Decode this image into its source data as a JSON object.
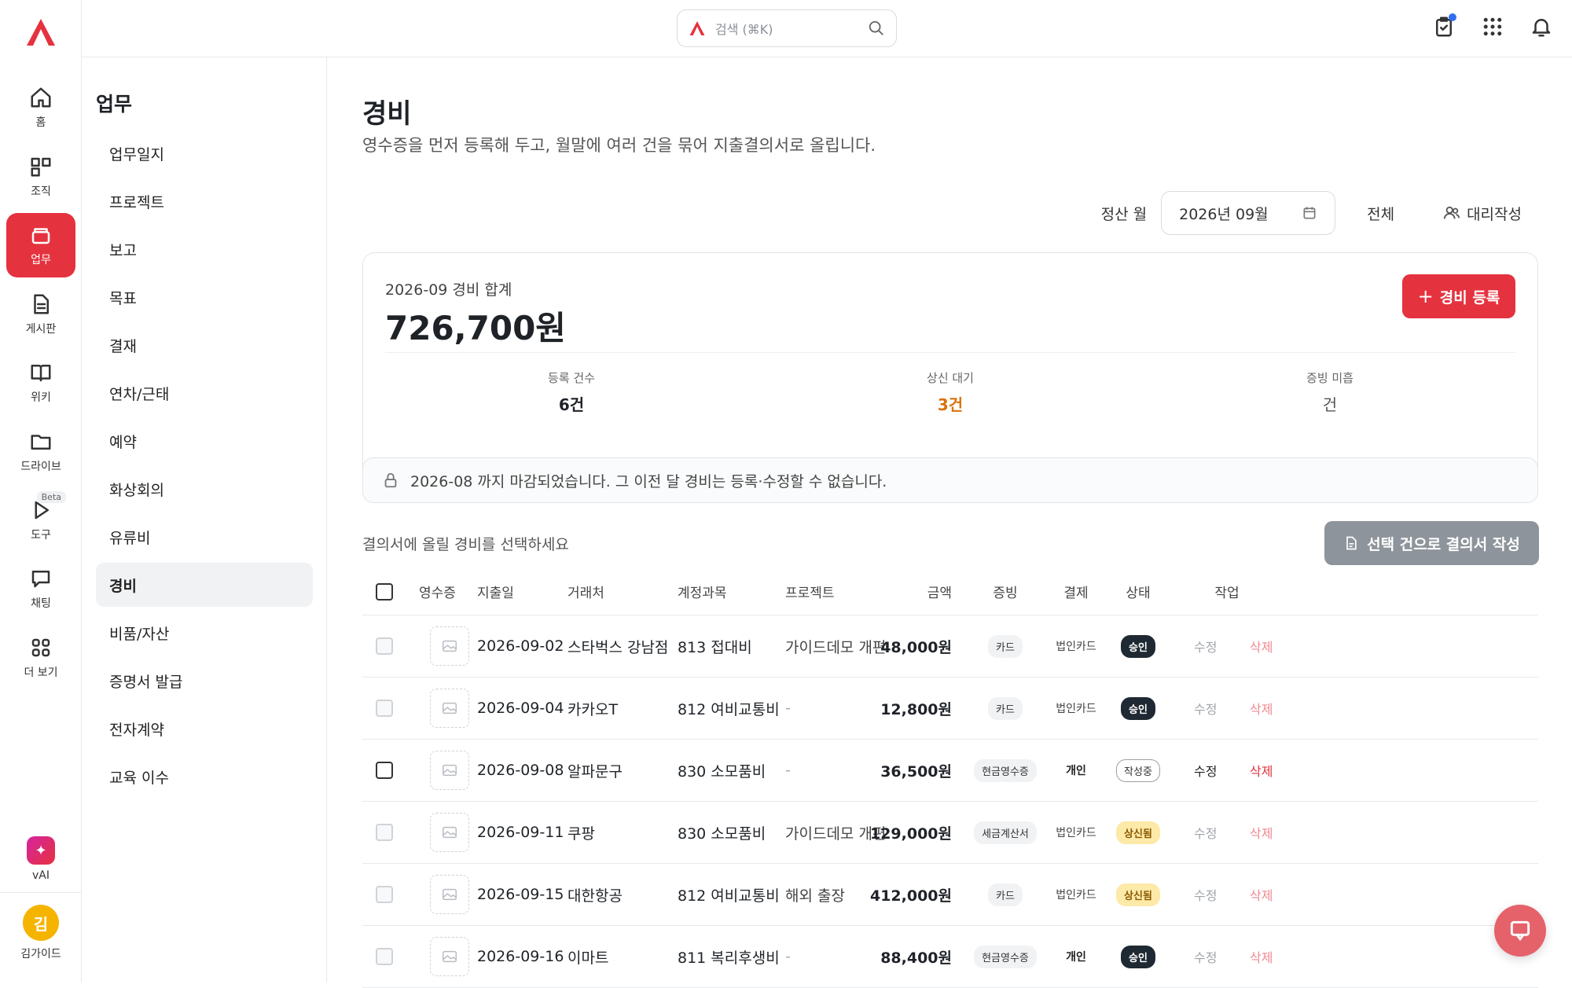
{
  "search": {
    "placeholder": "검색 (⌘K)"
  },
  "rail": {
    "items": [
      {
        "label": "홈"
      },
      {
        "label": "조직"
      },
      {
        "label": "업무"
      },
      {
        "label": "게시판"
      },
      {
        "label": "위키"
      },
      {
        "label": "드라이브"
      },
      {
        "label": "도구",
        "badge": "Beta"
      },
      {
        "label": "채팅"
      },
      {
        "label": "더 보기"
      }
    ],
    "vai_label": "vAI",
    "avatar_initial": "김",
    "user_name": "김가이드"
  },
  "subnav": {
    "title": "업무",
    "items": [
      "업무일지",
      "프로젝트",
      "보고",
      "목표",
      "결재",
      "연차/근태",
      "예약",
      "화상회의",
      "유류비",
      "경비",
      "비품/자산",
      "증명서 발급",
      "전자계약",
      "교육 이수"
    ],
    "active": "경비"
  },
  "page": {
    "title": "경비",
    "description": "영수증을 먼저 등록해 두고, 월말에 여러 건을 묶어 지출결의서로 올립니다."
  },
  "controls": {
    "month_label": "정산 월",
    "month_value": "2026년 09월",
    "all_label": "전체",
    "proxy_label": "대리작성"
  },
  "summary": {
    "label": "2026-09 경비 합계",
    "total": "726,700원",
    "add_button": "경비 등록",
    "stats": [
      {
        "label": "등록 건수",
        "value": "6건"
      },
      {
        "label": "상신 대기",
        "value": "3건"
      },
      {
        "label": "증빙 미흡",
        "value": "건"
      }
    ]
  },
  "notice": "2026-08 까지 마감되었습니다. 그 이전 달 경비는 등록·수정할 수 없습니다.",
  "selection": {
    "hint": "결의서에 올릴 경비를 선택하세요",
    "button": "선택 건으로 결의서 작성"
  },
  "table": {
    "headers": {
      "receipt": "영수증",
      "date": "지출일",
      "vendor": "거래처",
      "account": "계정과목",
      "project": "프로젝트",
      "amount": "금액",
      "proof": "증빙",
      "payment": "결제",
      "status": "상태",
      "action": "작업"
    },
    "rows": [
      {
        "date": "2026-09-02",
        "vendor": "스타벅스 강남점",
        "account": "813 접대비",
        "project": "가이드데모 개편",
        "amount": "48,000원",
        "proof": "카드",
        "payment": "법인카드",
        "status": "승인",
        "edit": "수정",
        "delete": "삭제"
      },
      {
        "date": "2026-09-04",
        "vendor": "카카오T",
        "account": "812 여비교통비",
        "project": "-",
        "amount": "12,800원",
        "proof": "카드",
        "payment": "법인카드",
        "status": "승인",
        "edit": "수정",
        "delete": "삭제"
      },
      {
        "date": "2026-09-08",
        "vendor": "알파문구",
        "account": "830 소모품비",
        "project": "-",
        "amount": "36,500원",
        "proof": "현금영수증",
        "payment": "개인",
        "status": "작성중",
        "edit": "수정",
        "delete": "삭제"
      },
      {
        "date": "2026-09-11",
        "vendor": "쿠팡",
        "account": "830 소모품비",
        "project": "가이드데모 개편",
        "amount": "129,000원",
        "proof": "세금계산서",
        "payment": "법인카드",
        "status": "상신됨",
        "edit": "수정",
        "delete": "삭제"
      },
      {
        "date": "2026-09-15",
        "vendor": "대한항공",
        "account": "812 여비교통비",
        "project": "해외 출장",
        "amount": "412,000원",
        "proof": "카드",
        "payment": "법인카드",
        "status": "상신됨",
        "edit": "수정",
        "delete": "삭제"
      },
      {
        "date": "2026-09-16",
        "vendor": "이마트",
        "account": "811 복리후생비",
        "project": "-",
        "amount": "88,400원",
        "proof": "현금영수증",
        "payment": "개인",
        "status": "승인",
        "edit": "수정",
        "delete": "삭제"
      }
    ]
  },
  "colors": {
    "accent": "#e5323f",
    "pending": "#d9730d"
  }
}
